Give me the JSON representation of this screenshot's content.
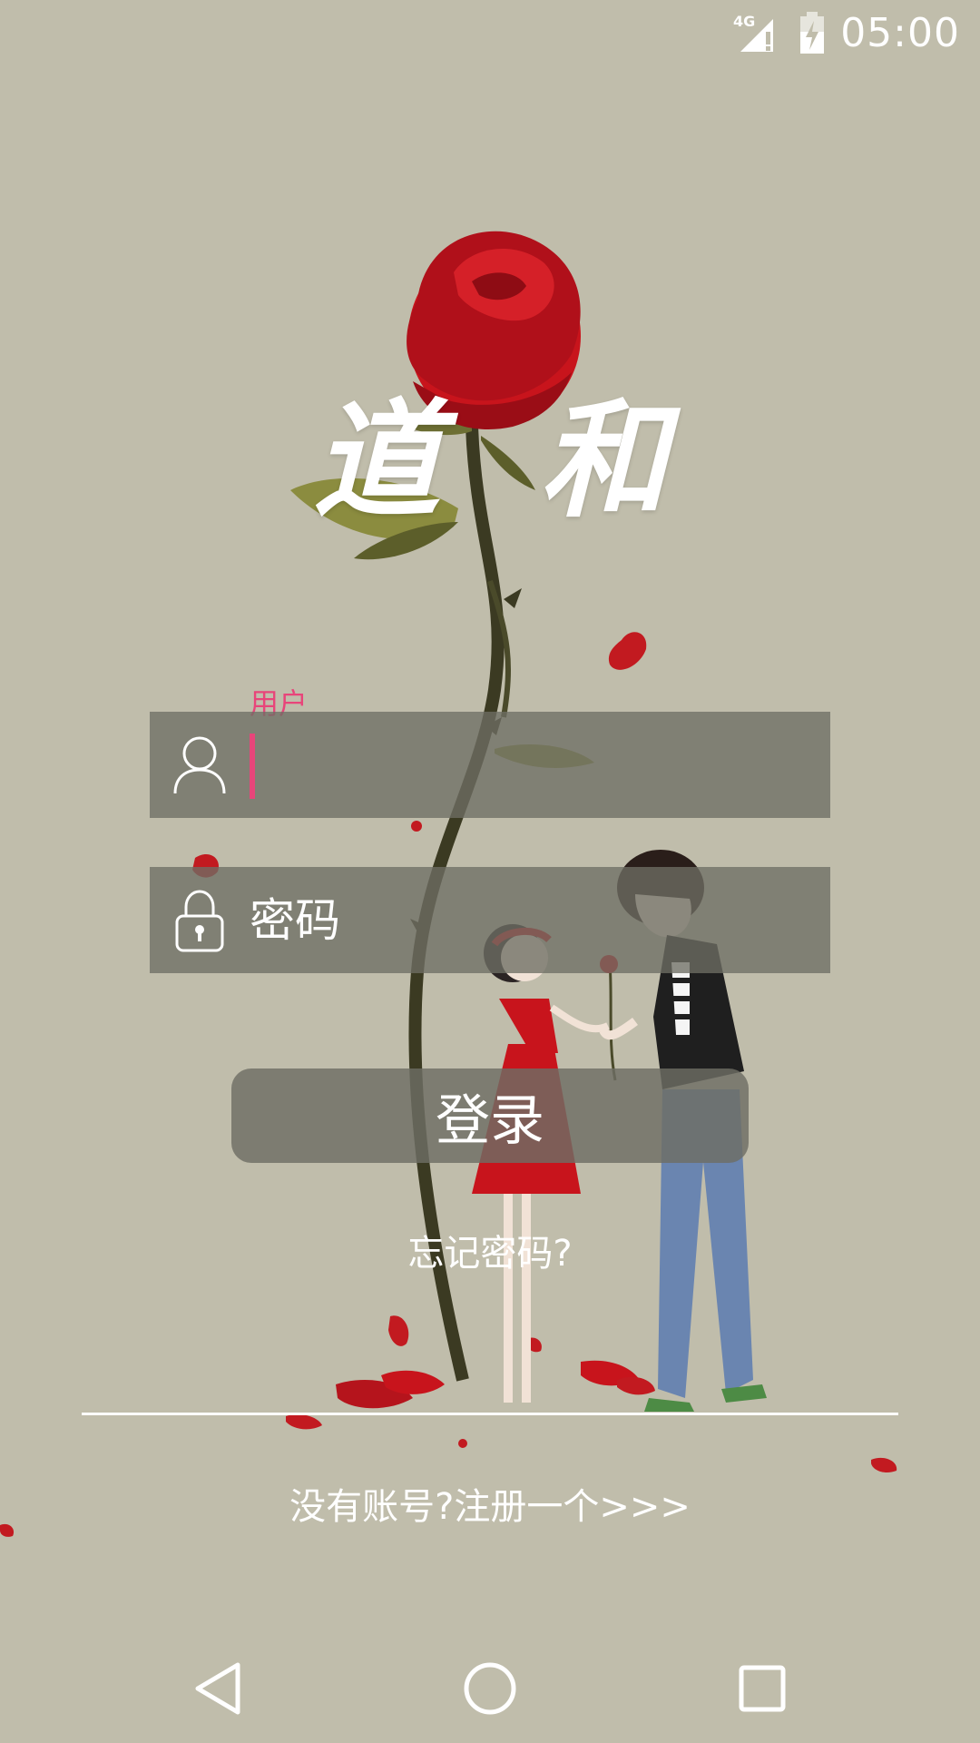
{
  "status_bar": {
    "network": "4G",
    "time": "05:00"
  },
  "brand": {
    "title": "道和"
  },
  "login_form": {
    "username_label": "用户",
    "username_value": "",
    "password_placeholder": "密码",
    "login_button": "登录",
    "forgot_password": "忘记密码?"
  },
  "footer": {
    "register_link": "没有账号?注册一个>>>"
  },
  "nav_bar": {
    "back_icon": "triangle-back-icon",
    "home_icon": "circle-home-icon",
    "recents_icon": "square-recents-icon"
  },
  "colors": {
    "background": "#c0bdab",
    "accent": "#e8457a",
    "field_bg": "#6e6e64"
  }
}
